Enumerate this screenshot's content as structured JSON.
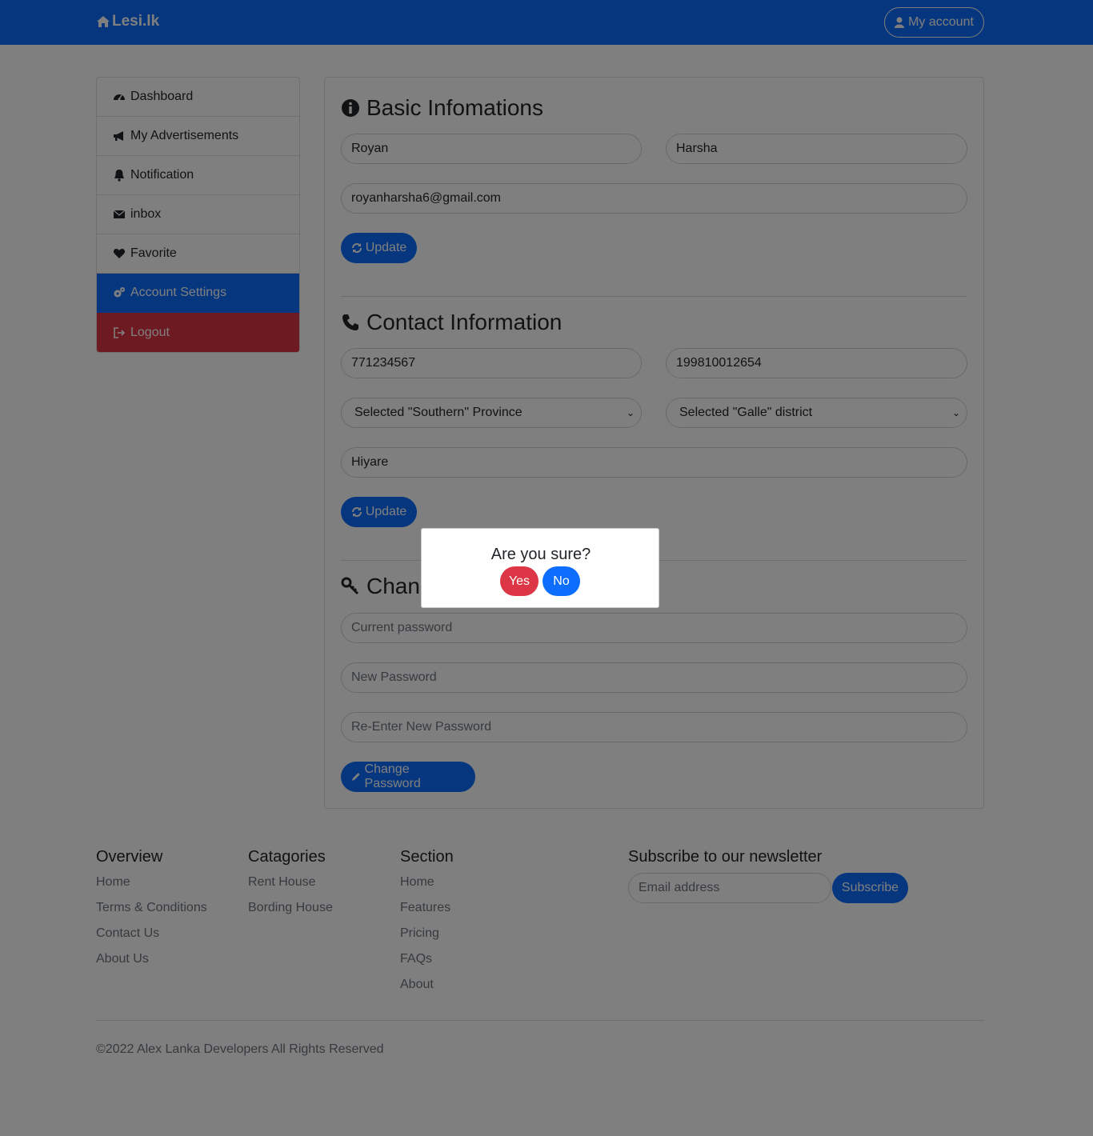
{
  "navbar": {
    "brand": "Lesi.lk",
    "account_label": "My account",
    "color": "#0d6efd"
  },
  "sidebar": {
    "items": [
      {
        "label": "Dashboard",
        "icon": "dashboard-icon"
      },
      {
        "label": "My Advertisements",
        "icon": "bullhorn-icon"
      },
      {
        "label": "Notification",
        "icon": "bell-icon"
      },
      {
        "label": "inbox",
        "icon": "envelope-icon"
      },
      {
        "label": "Favorite",
        "icon": "heart-icon"
      },
      {
        "label": "Account Settings",
        "icon": "cogs-icon",
        "state": "active"
      },
      {
        "label": "Logout",
        "icon": "sign-out-icon",
        "state": "danger"
      }
    ]
  },
  "basic": {
    "title": "Basic Infomations",
    "first_name": "Royan",
    "last_name": "Harsha",
    "email": "royanharsha6@gmail.com",
    "update_label": "Update"
  },
  "contact": {
    "title": "Contact Information",
    "phone": "771234567",
    "nic": "199810012654",
    "province": "Selected \"Southern\" Province",
    "district": "Selected \"Galle\" district",
    "city": "Hiyare",
    "update_label": "Update"
  },
  "password": {
    "title": "Chan",
    "current_placeholder": "Current password",
    "new_placeholder": "New Password",
    "reenter_placeholder": "Re-Enter New Password",
    "change_label": "Change Password"
  },
  "footer": {
    "overview": {
      "title": "Overview",
      "links": [
        "Home",
        "Terms & Conditions",
        "Contact Us",
        "About Us"
      ]
    },
    "categories": {
      "title": "Catagories",
      "links": [
        "Rent House",
        "Bording House"
      ]
    },
    "section": {
      "title": "Section",
      "links": [
        "Home",
        "Features",
        "Pricing",
        "FAQs",
        "About"
      ]
    },
    "newsletter": {
      "title": "Subscribe to our newsletter",
      "placeholder": "Email address",
      "button": "Subscribe"
    },
    "copyright": "©2022 Alex Lanka Developers All Rights Reserved"
  },
  "modal": {
    "text": "Are you sure?",
    "yes": "Yes",
    "no": "No",
    "yes_color": "#dc3545",
    "no_color": "#0d6efd"
  }
}
